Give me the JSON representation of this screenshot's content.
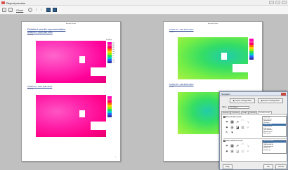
{
  "window": {
    "title": "Report preview"
  },
  "toolbar": {
    "close_label": "Close",
    "icons": [
      "print-icon",
      "save-icon",
      "zoom-icon",
      "previous-icon",
      "next-icon",
      "single-page-icon",
      "two-page-icon"
    ],
    "nav_prev": "‹",
    "nav_next": "›"
  },
  "page1": {
    "header": "Example Report",
    "title": "Detailed results representation",
    "section1_title": "Surface S1 - upper plate stress",
    "section1_sub": "σx [MPa]",
    "section2_title": "Surface S2 - lower plate stress",
    "section2_sub": "σx [MPa]",
    "legend_title": "σx [MPa]",
    "legend_values": [
      "32.5",
      "28.1",
      "23.7",
      "19.3",
      "14.9",
      "10.5",
      "6.1",
      "1.7",
      "-2.7",
      "-7.1"
    ],
    "page_number": "1"
  },
  "page2": {
    "header": "Example Report",
    "section1_title": "Surface S1 - total deformation",
    "section1_sub": "u [mm]",
    "section2_title": "Surface S2 - total deformation",
    "section2_sub": "u [mm]"
  },
  "colors": {
    "magenta": "#ff00b4",
    "green": "#33dd44"
  },
  "dialog": {
    "title": "Navigator",
    "import_button": "Import Configuration",
    "export_button": "Export Configuration",
    "name_label": "Name:",
    "name_value": "Print Report",
    "tabs": [
      "General",
      "Structure",
      "Loads",
      "Results",
      "Detailed results"
    ],
    "active_tab": "Detailed results",
    "check1_label": "Show detailed results",
    "check1_checked": "✓",
    "check2_label": "Show additional results",
    "check2_checked": "✓",
    "list1": [
      "Stress field",
      "Internal forces",
      "Deformations",
      "Reactions",
      "Design results",
      "Contact stress",
      "Soil pressure",
      "Plate moments",
      "Member forces",
      "Node results"
    ],
    "list1_selected": 4,
    "list2": [
      "Total deformation",
      "Displacement ux",
      "Displacement uy",
      "Displacement uz",
      "Rotation φx",
      "Rotation φy"
    ],
    "list2_selected": 0,
    "ok_button": "OK",
    "cancel_button": "Cancel",
    "help_button": "Help"
  }
}
